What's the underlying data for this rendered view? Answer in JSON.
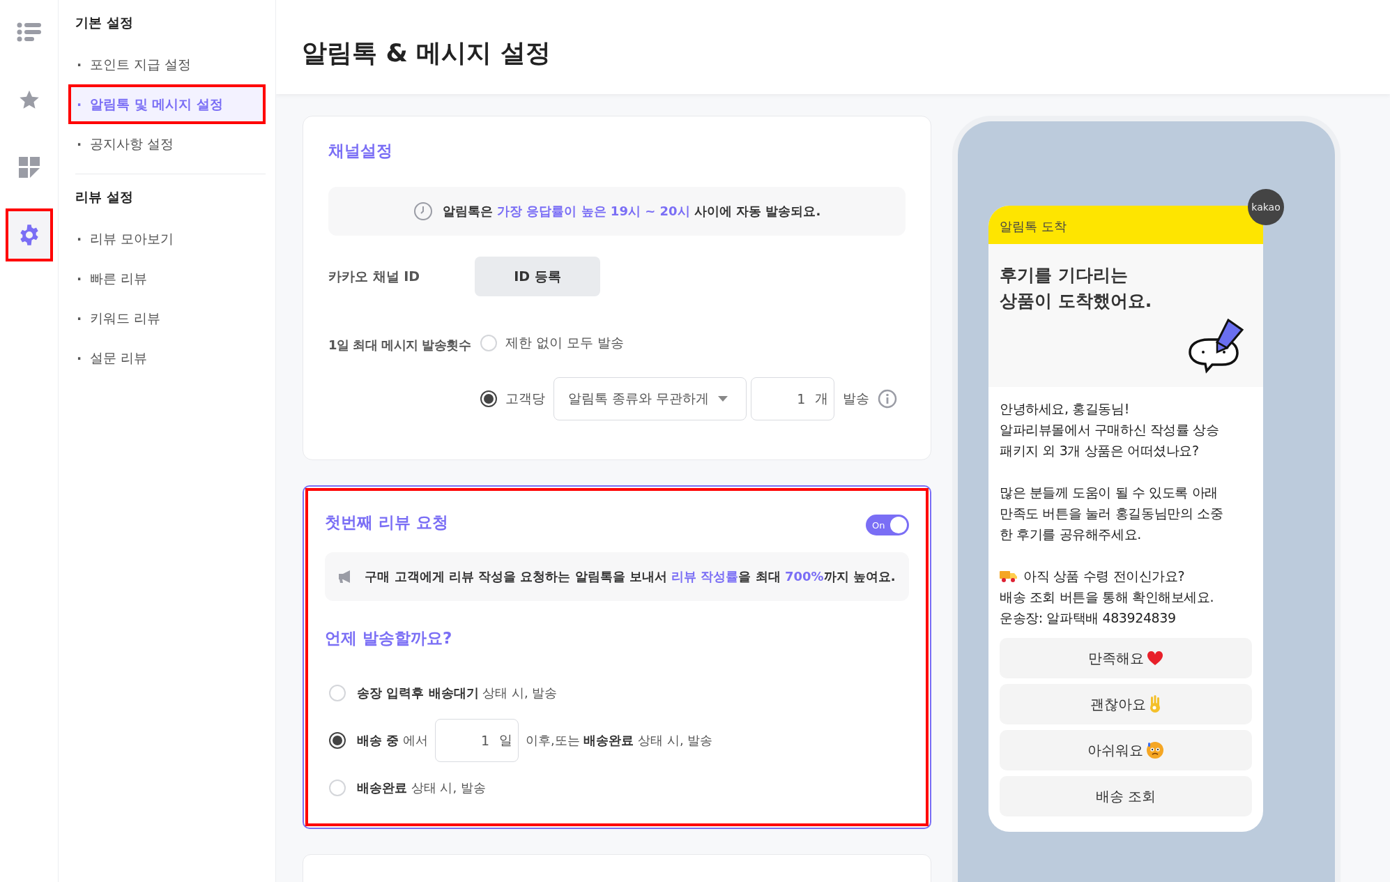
{
  "rail": [
    {
      "selected": false,
      "annotated": false
    },
    {
      "selected": false,
      "annotated": false
    },
    {
      "selected": false,
      "annotated": false
    },
    {
      "selected": true,
      "annotated": true
    }
  ],
  "sidebar": {
    "groups": [
      {
        "title": "기본 설정",
        "items": [
          {
            "bullet": "·",
            "label": "포인트 지급 설정",
            "selected": false,
            "annotated": false
          },
          {
            "bullet": "·",
            "label": "알림톡 및 메시지 설정",
            "selected": true,
            "annotated": true
          },
          {
            "bullet": "·",
            "label": "공지사항 설정",
            "selected": false,
            "annotated": false
          }
        ]
      },
      {
        "title": "리뷰 설정",
        "items": [
          {
            "bullet": "·",
            "label": "리뷰 모아보기",
            "selected": false,
            "annotated": false
          },
          {
            "bullet": "·",
            "label": "빠른 리뷰",
            "selected": false,
            "annotated": false
          },
          {
            "bullet": "·",
            "label": "키워드 리뷰",
            "selected": false,
            "annotated": false
          },
          {
            "bullet": "·",
            "label": "설문 리뷰",
            "selected": false,
            "annotated": false
          }
        ]
      }
    ]
  },
  "header": {
    "title": "알림톡 & 메시지 설정"
  },
  "channel_card": {
    "title": "채널설정",
    "notice": [
      {
        "text": "알림톡은 ",
        "highlight": false
      },
      {
        "text": "가장 응답률이 높은 19시 ~ 20시",
        "highlight": true
      },
      {
        "text": " 사이에 자동 발송되요.",
        "highlight": false
      }
    ],
    "kakao_id": {
      "label": "카카오 채널 ID",
      "button": "ID 등록"
    },
    "daily_limit": {
      "label": "1일 최대 메시지 발송횟수",
      "options": [
        {
          "kind": "plain",
          "label": "제한 없이 모두 발송",
          "selected": false
        },
        {
          "kind": "per_customer",
          "label": "고객당",
          "selected": true,
          "dropdown": "알림톡 종류와 무관하게",
          "count": "1",
          "unit": "개",
          "suffix": "발송"
        }
      ]
    }
  },
  "review_card": {
    "title": "첫번째 리뷰 요청",
    "annotated": true,
    "toggle": {
      "label": "On",
      "on": true
    },
    "notice": [
      {
        "text": "구매 고객에게 리뷰 작성을 요청하는 알림톡을 보내서 ",
        "highlight": false
      },
      {
        "text": "리뷰 작성률",
        "highlight": true
      },
      {
        "text": "을 최대 ",
        "highlight": false
      },
      {
        "text": "700%",
        "highlight": true
      },
      {
        "text": "까지 높여요.",
        "highlight": false
      }
    ],
    "question": "언제 발송할까요?",
    "options": [
      {
        "kind": "plain",
        "label": "**송장 입력후 배송대기** 상태 시, 발송",
        "selected": false
      },
      {
        "kind": "days",
        "before": "**배송 중** 에서",
        "value": "1",
        "unit": "일",
        "after": "이후,또는 **배송완료** 상태 시, 발송",
        "selected": true
      },
      {
        "kind": "plain",
        "label": "**배송완료** 상태 시, 발송",
        "selected": false
      }
    ]
  },
  "preview": {
    "badge": "kakao",
    "header": "알림톡 도착",
    "title": "후기를 기다리는\n상품이 도착했어요.",
    "paragraphs": [
      {
        "kind": "text",
        "text": "안녕하세요, 홍길동님!\n알파리뷰몰에서 구매하신 작성률 상승\n패키지 외 3개 상품은 어떠셨나요?"
      },
      {
        "kind": "text",
        "text": "많은 분들께 도움이 될 수 있도록 아래\n만족도 버튼을 눌러 홍길동님만의 소중\n한 후기를 공유해주세요."
      },
      {
        "kind": "truck",
        "lead": "아직 상품 수령 전이신가요?",
        "text": "배송 조회 버튼을 통해 확인해보세요.\n운송장: 알파택배 483924839"
      }
    ],
    "buttons": [
      {
        "label": "만족해요"
      },
      {
        "label": "괜찮아요"
      },
      {
        "label": "아쉬워요"
      },
      {
        "label": "배송 조회"
      }
    ]
  }
}
